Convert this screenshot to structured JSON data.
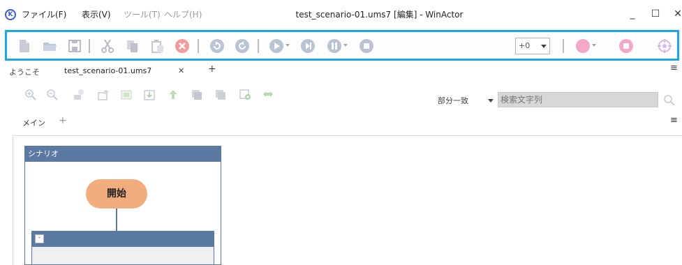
{
  "window": {
    "title": "test_scenario-01.ums7 [編集] - WinActor",
    "minimize": "_",
    "maximize": "☐",
    "close": "✕"
  },
  "menu": [
    {
      "label": "ファイル(F)",
      "enabled": true
    },
    {
      "label": "表示(V)",
      "enabled": true
    },
    {
      "label": "ツール(T)",
      "enabled": false
    },
    {
      "label": "ヘルプ(H)",
      "enabled": false
    }
  ],
  "toolbar": {
    "speed_value": "+0",
    "icons": [
      "new-file-icon",
      "open-folder-icon",
      "save-icon",
      "cut-icon",
      "copy-icon",
      "paste-icon",
      "delete-icon",
      "undo-icon",
      "redo-icon",
      "play-icon",
      "step-icon",
      "pause-icon",
      "stop-icon",
      "record-icon",
      "record-stop-icon",
      "target-icon"
    ],
    "colors": {
      "highlight": "#1aa7e8",
      "icon": "#b9c3d3",
      "record": "#f4a8c7",
      "delete": "#f39a9a"
    }
  },
  "tabs": {
    "welcome": "ようこそ",
    "file": "test_scenario-01.ums7",
    "close": "✕",
    "add": "+",
    "overflow": "≡"
  },
  "editor_toolbar": {
    "search_mode": "部分一致",
    "search_placeholder": "検索文字列",
    "icons": [
      "zoom-in-icon",
      "zoom-out-icon",
      "add-variable-icon",
      "add-node-icon",
      "import-icon",
      "export-icon",
      "move-icon",
      "copy-block-icon",
      "paste-block-icon",
      "add-child-icon",
      "swap-icon",
      "search-icon"
    ]
  },
  "subtabs": {
    "main": "メイン",
    "add": "+",
    "overflow": "≡"
  },
  "scenario": {
    "header": "シナリオ",
    "start_node": "開始",
    "group_collapse": "-"
  }
}
